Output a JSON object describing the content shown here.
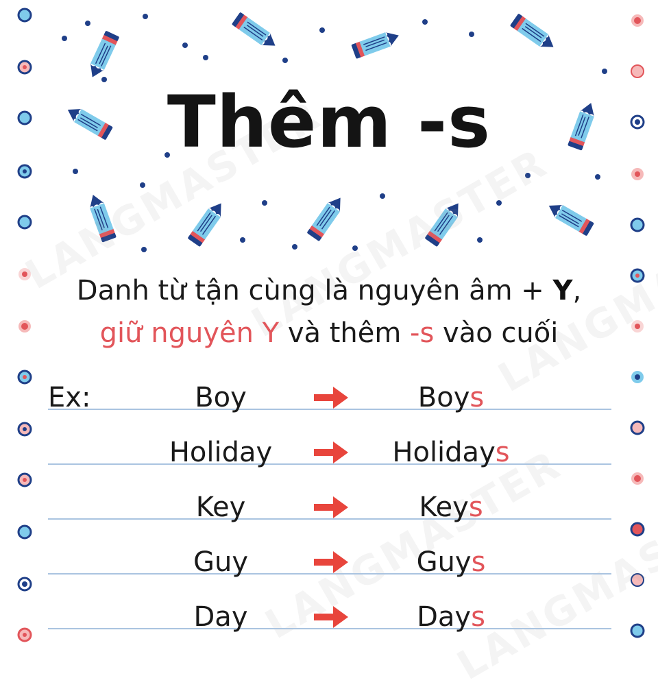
{
  "title": "Thêm -s",
  "description": {
    "line1_prefix": "Danh từ tận cùng là nguyên âm + ",
    "line1_bold": "Y",
    "line1_suffix": ",",
    "line2_red_1": "giữ nguyên Y",
    "line2_mid": " và thêm ",
    "line2_red_2": "-s",
    "line2_end": " vào cuối"
  },
  "examples": {
    "label": "Ex:",
    "rows": [
      {
        "base": "Boy",
        "plural_stem": "Boy",
        "suffix": "s"
      },
      {
        "base": "Holiday",
        "plural_stem": "Holiday",
        "suffix": "s"
      },
      {
        "base": "Key",
        "plural_stem": "Key",
        "suffix": "s"
      },
      {
        "base": "Guy",
        "plural_stem": "Guy",
        "suffix": "s"
      },
      {
        "base": "Day",
        "plural_stem": "Day",
        "suffix": "s"
      }
    ]
  },
  "watermark": "LANGMASTER",
  "colors": {
    "accent_red": "#e2555a",
    "pencil_blue": "#7fcbeb",
    "pencil_dark": "#1f3f88",
    "pencil_pink": "#e2555a",
    "rule_blue": "#aac4e0",
    "arrow_red": "#e8453c"
  },
  "icons": [
    "pencil-icon",
    "arrow-right-icon",
    "dot-ring-icon"
  ]
}
